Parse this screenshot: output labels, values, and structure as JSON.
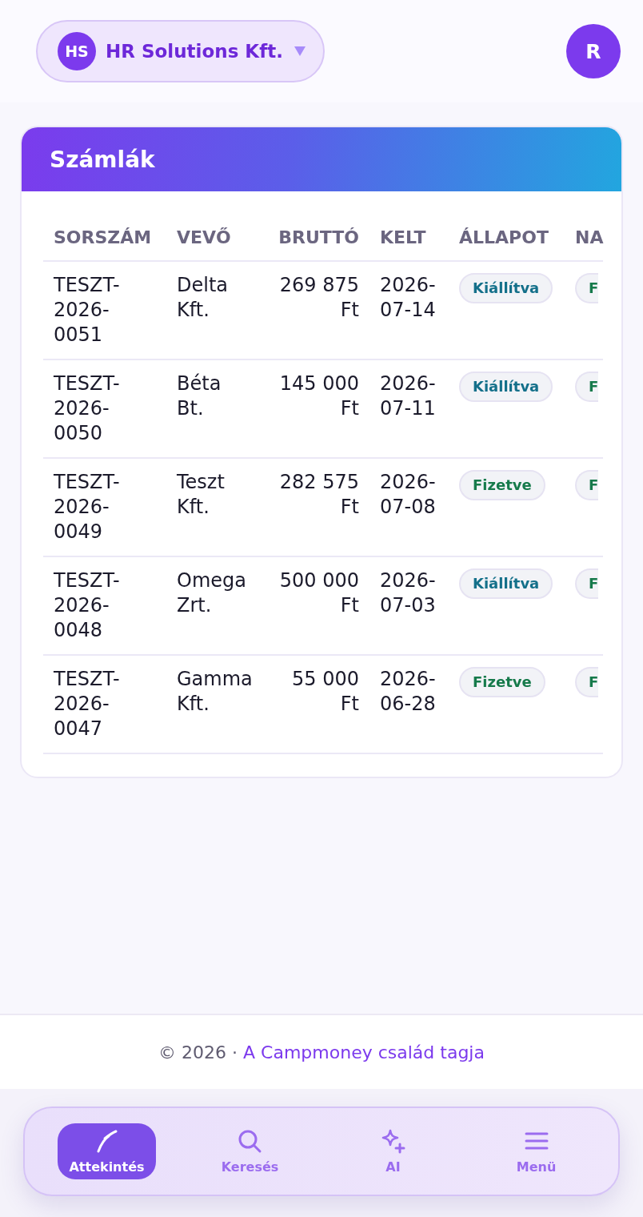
{
  "header": {
    "company": {
      "initials": "HS",
      "name": "HR Solutions Kft."
    },
    "user": {
      "initial": "R"
    }
  },
  "invoices": {
    "title": "Számlák",
    "columns": [
      "SORSZÁM",
      "VEVŐ",
      "BRUTTÓ",
      "KELT",
      "ÁLLAPOT",
      "NA"
    ],
    "rows": [
      {
        "number": "TESZT-2026-0051",
        "customer": "Delta Kft.",
        "gross": "269 875 Ft",
        "date": "2026-07-14",
        "status": {
          "label": "Kiállítva",
          "kind": "issued"
        },
        "column_6": {
          "label": "F",
          "kind": "paid"
        }
      },
      {
        "number": "TESZT-2026-0050",
        "customer": "Béta Bt.",
        "gross": "145 000 Ft",
        "date": "2026-07-11",
        "status": {
          "label": "Kiállítva",
          "kind": "issued"
        },
        "column_6": {
          "label": "F",
          "kind": "paid"
        }
      },
      {
        "number": "TESZT-2026-0049",
        "customer": "Teszt Kft.",
        "gross": "282 575 Ft",
        "date": "2026-07-08",
        "status": {
          "label": "Fizetve",
          "kind": "paid"
        },
        "column_6": {
          "label": "F",
          "kind": "paid"
        }
      },
      {
        "number": "TESZT-2026-0048",
        "customer": "Omega Zrt.",
        "gross": "500 000 Ft",
        "date": "2026-07-03",
        "status": {
          "label": "Kiállítva",
          "kind": "issued"
        },
        "column_6": {
          "label": "F",
          "kind": "paid"
        }
      },
      {
        "number": "TESZT-2026-0047",
        "customer": "Gamma Kft.",
        "gross": "55 000 Ft",
        "date": "2026-06-28",
        "status": {
          "label": "Fizetve",
          "kind": "paid"
        },
        "column_6": {
          "label": "F",
          "kind": "paid"
        }
      }
    ]
  },
  "footer": {
    "copyright": "© 2026 ·",
    "link": "A Campmoney család tagja"
  },
  "bottom_nav": [
    {
      "label": "Attekintés",
      "kind": "overview",
      "selected": true
    },
    {
      "label": "Keresés",
      "kind": "search",
      "selected": false
    },
    {
      "label": "AI",
      "kind": "ai",
      "selected": false
    },
    {
      "label": "Menü",
      "kind": "menu",
      "selected": false
    }
  ]
}
